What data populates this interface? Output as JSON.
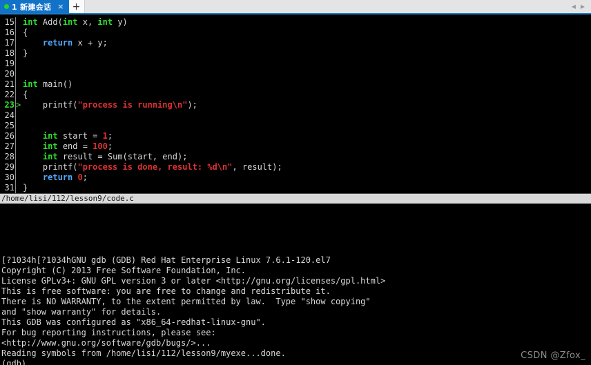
{
  "window": {
    "tab": {
      "label": "1 新建会话",
      "close_label": "×",
      "status_color": "#27d427"
    },
    "new_tab_label": "+",
    "nav_prev_label": "◀",
    "nav_next_label": "▶"
  },
  "source_pane": {
    "lines": [
      {
        "num": "15",
        "marker": " ",
        "current": false,
        "tokens": [
          {
            "t": "int",
            "c": "kw"
          },
          {
            "t": " Add(",
            "c": "pln"
          },
          {
            "t": "int",
            "c": "kw"
          },
          {
            "t": " x, ",
            "c": "pln"
          },
          {
            "t": "int",
            "c": "kw"
          },
          {
            "t": " y)",
            "c": "pln"
          }
        ]
      },
      {
        "num": "16",
        "marker": " ",
        "current": false,
        "tokens": [
          {
            "t": "{",
            "c": "pln"
          }
        ]
      },
      {
        "num": "17",
        "marker": " ",
        "current": false,
        "tokens": [
          {
            "t": "    ",
            "c": "pln"
          },
          {
            "t": "return",
            "c": "kw2"
          },
          {
            "t": " x + y;",
            "c": "pln"
          }
        ]
      },
      {
        "num": "18",
        "marker": " ",
        "current": false,
        "tokens": [
          {
            "t": "}",
            "c": "pln"
          }
        ]
      },
      {
        "num": "19",
        "marker": " ",
        "current": false,
        "tokens": []
      },
      {
        "num": "20",
        "marker": " ",
        "current": false,
        "tokens": []
      },
      {
        "num": "21",
        "marker": " ",
        "current": false,
        "tokens": [
          {
            "t": "int",
            "c": "kw"
          },
          {
            "t": " main()",
            "c": "pln"
          }
        ]
      },
      {
        "num": "22",
        "marker": " ",
        "current": false,
        "tokens": [
          {
            "t": "{",
            "c": "pln"
          }
        ]
      },
      {
        "num": "23",
        "marker": ">",
        "current": true,
        "tokens": [
          {
            "t": "    printf(",
            "c": "pln"
          },
          {
            "t": "\"process is running\\n\"",
            "c": "str"
          },
          {
            "t": ");",
            "c": "pln"
          }
        ]
      },
      {
        "num": "24",
        "marker": " ",
        "current": false,
        "tokens": []
      },
      {
        "num": "25",
        "marker": " ",
        "current": false,
        "tokens": []
      },
      {
        "num": "26",
        "marker": " ",
        "current": false,
        "tokens": [
          {
            "t": "    ",
            "c": "pln"
          },
          {
            "t": "int",
            "c": "kw"
          },
          {
            "t": " start = ",
            "c": "pln"
          },
          {
            "t": "1",
            "c": "num"
          },
          {
            "t": ";",
            "c": "pln"
          }
        ]
      },
      {
        "num": "27",
        "marker": " ",
        "current": false,
        "tokens": [
          {
            "t": "    ",
            "c": "pln"
          },
          {
            "t": "int",
            "c": "kw"
          },
          {
            "t": " end = ",
            "c": "pln"
          },
          {
            "t": "100",
            "c": "num"
          },
          {
            "t": ";",
            "c": "pln"
          }
        ]
      },
      {
        "num": "28",
        "marker": " ",
        "current": false,
        "tokens": [
          {
            "t": "    ",
            "c": "pln"
          },
          {
            "t": "int",
            "c": "kw"
          },
          {
            "t": " result = Sum(start, end);",
            "c": "pln"
          }
        ]
      },
      {
        "num": "29",
        "marker": " ",
        "current": false,
        "tokens": [
          {
            "t": "    printf(",
            "c": "pln"
          },
          {
            "t": "\"process is done, result: %d\\n\"",
            "c": "str"
          },
          {
            "t": ", result);",
            "c": "pln"
          }
        ]
      },
      {
        "num": "30",
        "marker": " ",
        "current": false,
        "tokens": [
          {
            "t": "    ",
            "c": "pln"
          },
          {
            "t": "return",
            "c": "kw2"
          },
          {
            "t": " ",
            "c": "pln"
          },
          {
            "t": "0",
            "c": "num"
          },
          {
            "t": ";",
            "c": "pln"
          }
        ]
      },
      {
        "num": "31",
        "marker": " ",
        "current": false,
        "tokens": [
          {
            "t": "}",
            "c": "pln"
          }
        ]
      }
    ]
  },
  "status_bar": {
    "text": "/home/lisi/112/lesson9/code.c"
  },
  "console": {
    "blank_lines_before": 5,
    "lines": [
      "[?1034h[?1034hGNU gdb (GDB) Red Hat Enterprise Linux 7.6.1-120.el7",
      "Copyright (C) 2013 Free Software Foundation, Inc.",
      "License GPLv3+: GNU GPL version 3 or later <http://gnu.org/licenses/gpl.html>",
      "This is free software: you are free to change and redistribute it.",
      "There is NO WARRANTY, to the extent permitted by law.  Type \"show copying\"",
      "and \"show warranty\" for details.",
      "This GDB was configured as \"x86_64-redhat-linux-gnu\".",
      "For bug reporting instructions, please see:",
      "<http://www.gnu.org/software/gdb/bugs/>...",
      "Reading symbols from /home/lisi/112/lesson9/myexe...done.",
      "(gdb)"
    ]
  },
  "watermark": {
    "text": "CSDN @Zfox_"
  }
}
